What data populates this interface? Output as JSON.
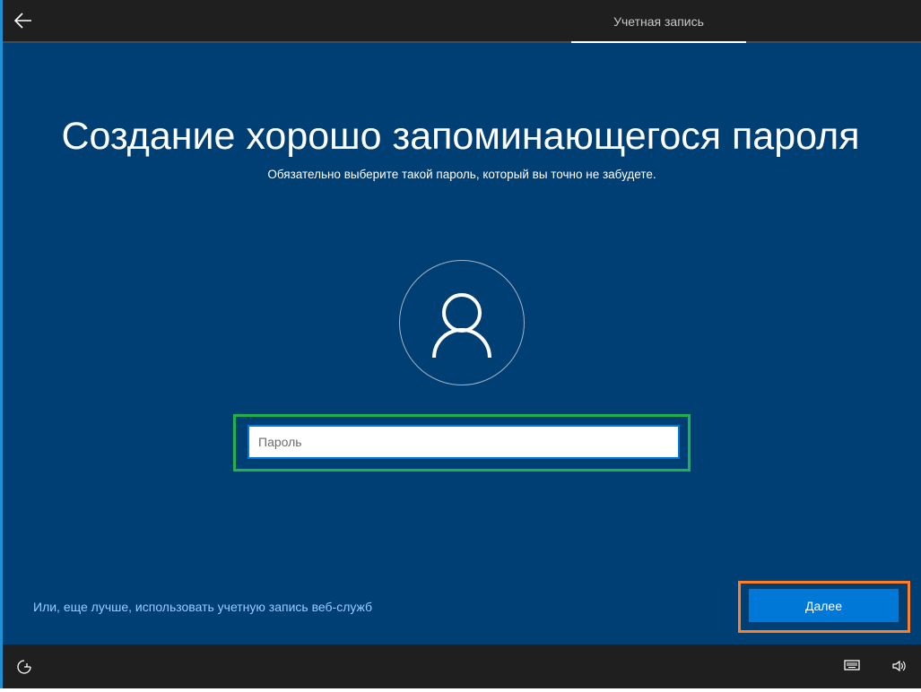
{
  "header": {
    "tab_label": "Учетная запись"
  },
  "main": {
    "title": "Создание хорошо запоминающегося пароля",
    "subtitle": "Обязательно выберите такой пароль, который вы точно не забудете.",
    "password_placeholder": "Пароль",
    "web_account_link": "Или, еще лучше, использовать учетную запись веб-служб",
    "next_label": "Далее"
  },
  "colors": {
    "background": "#003f74",
    "accent": "#0078d7",
    "highlight_green": "#22b14c",
    "highlight_orange": "#ff7f27"
  }
}
